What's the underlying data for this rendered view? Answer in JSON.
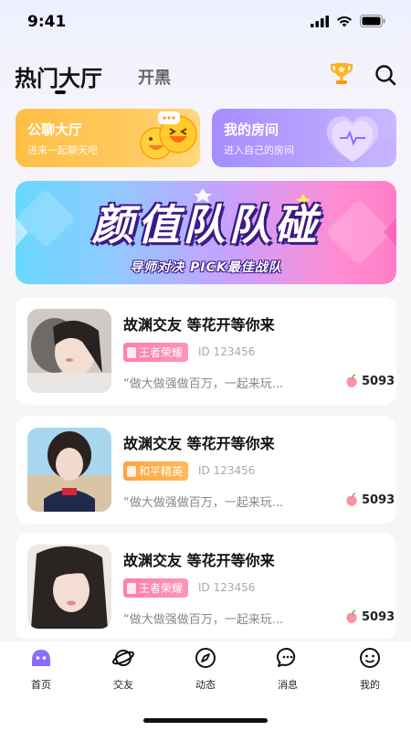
{
  "status_bar": {
    "time": "9:41"
  },
  "header": {
    "main_tab": "热门大厅",
    "sub_tab": "开黑",
    "trophy_icon": "trophy-icon",
    "search_icon": "search-icon"
  },
  "quick_cards": [
    {
      "title": "公聊大厅",
      "subtitle": "进来一起聊天吧",
      "color": "#ffbf46"
    },
    {
      "title": "我的房间",
      "subtitle": "进入自己的房间",
      "color": "#a48dff"
    }
  ],
  "banner": {
    "title": "颜值队队碰",
    "subtitle": "导师对决 PICK最佳战队"
  },
  "rooms": [
    {
      "title": "故渊交友 等花开等你来",
      "tag": "王者荣耀",
      "id": "ID 123456",
      "quote": "“做大做强做百万，一起来玩...",
      "heat": "5093"
    },
    {
      "title": "故渊交友 等花开等你来",
      "tag": "和平精英",
      "id": "ID 123456",
      "quote": "“做大做强做百万，一起来玩...",
      "heat": "5093"
    },
    {
      "title": "故渊交友 等花开等你来",
      "tag": "王者荣耀",
      "id": "ID 123456",
      "quote": "“做大做强做百万，一起来玩...",
      "heat": "5093"
    }
  ],
  "tabbar": [
    {
      "label": "首页",
      "icon": "home-icon"
    },
    {
      "label": "交友",
      "icon": "planet-icon"
    },
    {
      "label": "动态",
      "icon": "compass-icon"
    },
    {
      "label": "消息",
      "icon": "message-icon"
    },
    {
      "label": "我的",
      "icon": "profile-icon"
    }
  ],
  "colors": {
    "accent_purple": "#8b6cff",
    "tag_pink": "#ff7fa8",
    "tag_orange": "#ffa23c"
  }
}
